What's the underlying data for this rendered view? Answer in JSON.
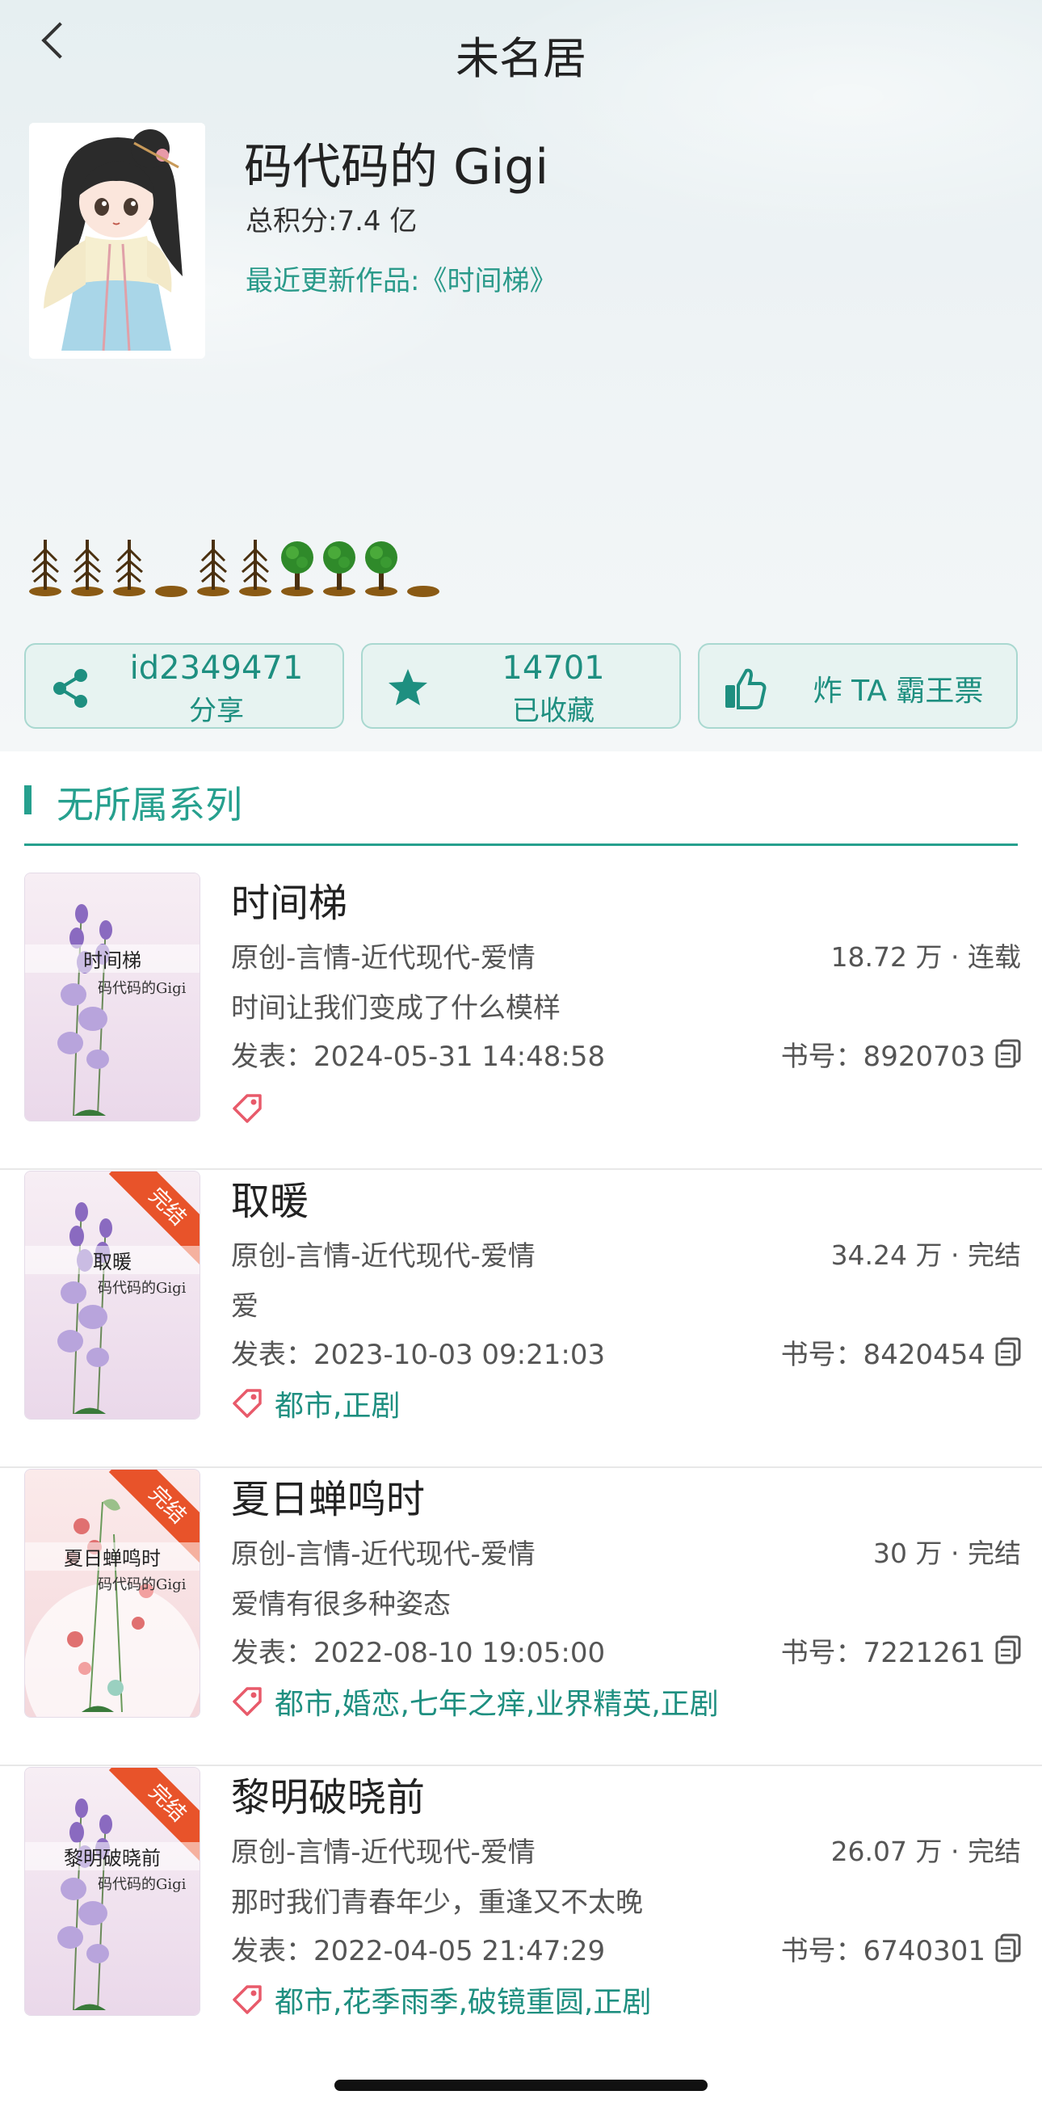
{
  "nav": {
    "title": "未名居"
  },
  "profile": {
    "name": "码代码的 Gigi",
    "total_score": "总积分:7.4 亿",
    "recent_work": "最近更新作品:《时间梯》"
  },
  "actions": {
    "share": {
      "top": "id2349471",
      "bottom": "分享"
    },
    "favorite": {
      "top": "14701",
      "bottom": "已收藏"
    },
    "vote": {
      "label": "炸 TA 霸王票"
    }
  },
  "section": {
    "title": "无所属系列"
  },
  "books": [
    {
      "title": "时间梯",
      "category": "原创-言情-近代现代-爱情",
      "stat": "18.72 万 · 连载",
      "desc": "时间让我们变成了什么模样",
      "date": "发表：2024-05-31 14:48:58",
      "book_id": "书号：8920703",
      "tags": "",
      "cover_title": "时间梯",
      "cover_author": "码代码的Gigi",
      "ribbon": ""
    },
    {
      "title": "取暖",
      "category": "原创-言情-近代现代-爱情",
      "stat": "34.24 万 · 完结",
      "desc": "爱",
      "date": "发表：2023-10-03 09:21:03",
      "book_id": "书号：8420454",
      "tags": "都市,正剧",
      "cover_title": "取暖",
      "cover_author": "码代码的Gigi",
      "ribbon": "完结"
    },
    {
      "title": "夏日蝉鸣时",
      "category": "原创-言情-近代现代-爱情",
      "stat": "30 万 · 完结",
      "desc": "爱情有很多种姿态",
      "date": "发表：2022-08-10 19:05:00",
      "book_id": "书号：7221261",
      "tags": "都市,婚恋,七年之痒,业界精英,正剧",
      "cover_title": "夏日蝉鸣时",
      "cover_author": "码代码的Gigi",
      "ribbon": "完结"
    },
    {
      "title": "黎明破晓前",
      "category": "原创-言情-近代现代-爱情",
      "stat": "26.07 万 · 完结",
      "desc": "那时我们青春年少，重逢又不太晚",
      "date": "发表：2022-04-05 21:47:29",
      "book_id": "书号：6740301",
      "tags": "都市,花季雨季,破镜重圆,正剧",
      "cover_title": "黎明破晓前",
      "cover_author": "码代码的Gigi",
      "ribbon": "完结"
    }
  ],
  "colors": {
    "accent": "#26a08e",
    "button_bg": "#e7f3f1",
    "ribbon": "#e8532a",
    "tag": "#e85a6a"
  }
}
